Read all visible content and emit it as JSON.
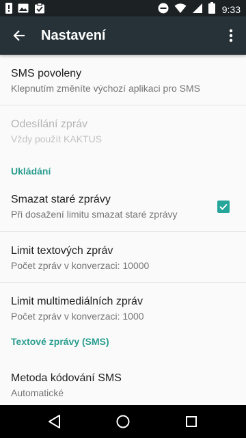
{
  "status_bar": {
    "time": "9:33",
    "icons_left": [
      "alert-icon",
      "image-icon",
      "clipboard-check-icon"
    ],
    "icons_right": [
      "do-not-disturb-icon",
      "wifi-icon",
      "cellular-icon",
      "battery-icon"
    ]
  },
  "app_bar": {
    "title": "Nastavení",
    "background_color": "#263238"
  },
  "preferences": {
    "sms_enabled": {
      "title": "SMS povoleny",
      "summary": "Klepnutím změníte výchozí aplikaci pro SMS"
    },
    "sending": {
      "title": "Odesílání zpráv",
      "summary": "Vždy použít KAKTUS",
      "enabled": false
    },
    "storage_category": "Ukládání",
    "delete_old": {
      "title": "Smazat staré zprávy",
      "summary": "Při dosažení limitu smazat staré zprávy",
      "checked": true
    },
    "text_limit": {
      "title": "Limit textových zpráv",
      "summary": "Počet zpráv v konverzaci: 10000"
    },
    "mms_limit": {
      "title": "Limit multimediálních zpráv",
      "summary": "Počet zpráv v konverzaci: 1000"
    },
    "sms_category": "Textové zprávy (SMS)",
    "encoding": {
      "title": "Metoda kódování SMS",
      "summary": "Automatické"
    }
  },
  "colors": {
    "accent": "#26a69a",
    "category_text": "#2a9d8f",
    "status_bar": "#1c2124",
    "nav_bar": "#000000"
  }
}
